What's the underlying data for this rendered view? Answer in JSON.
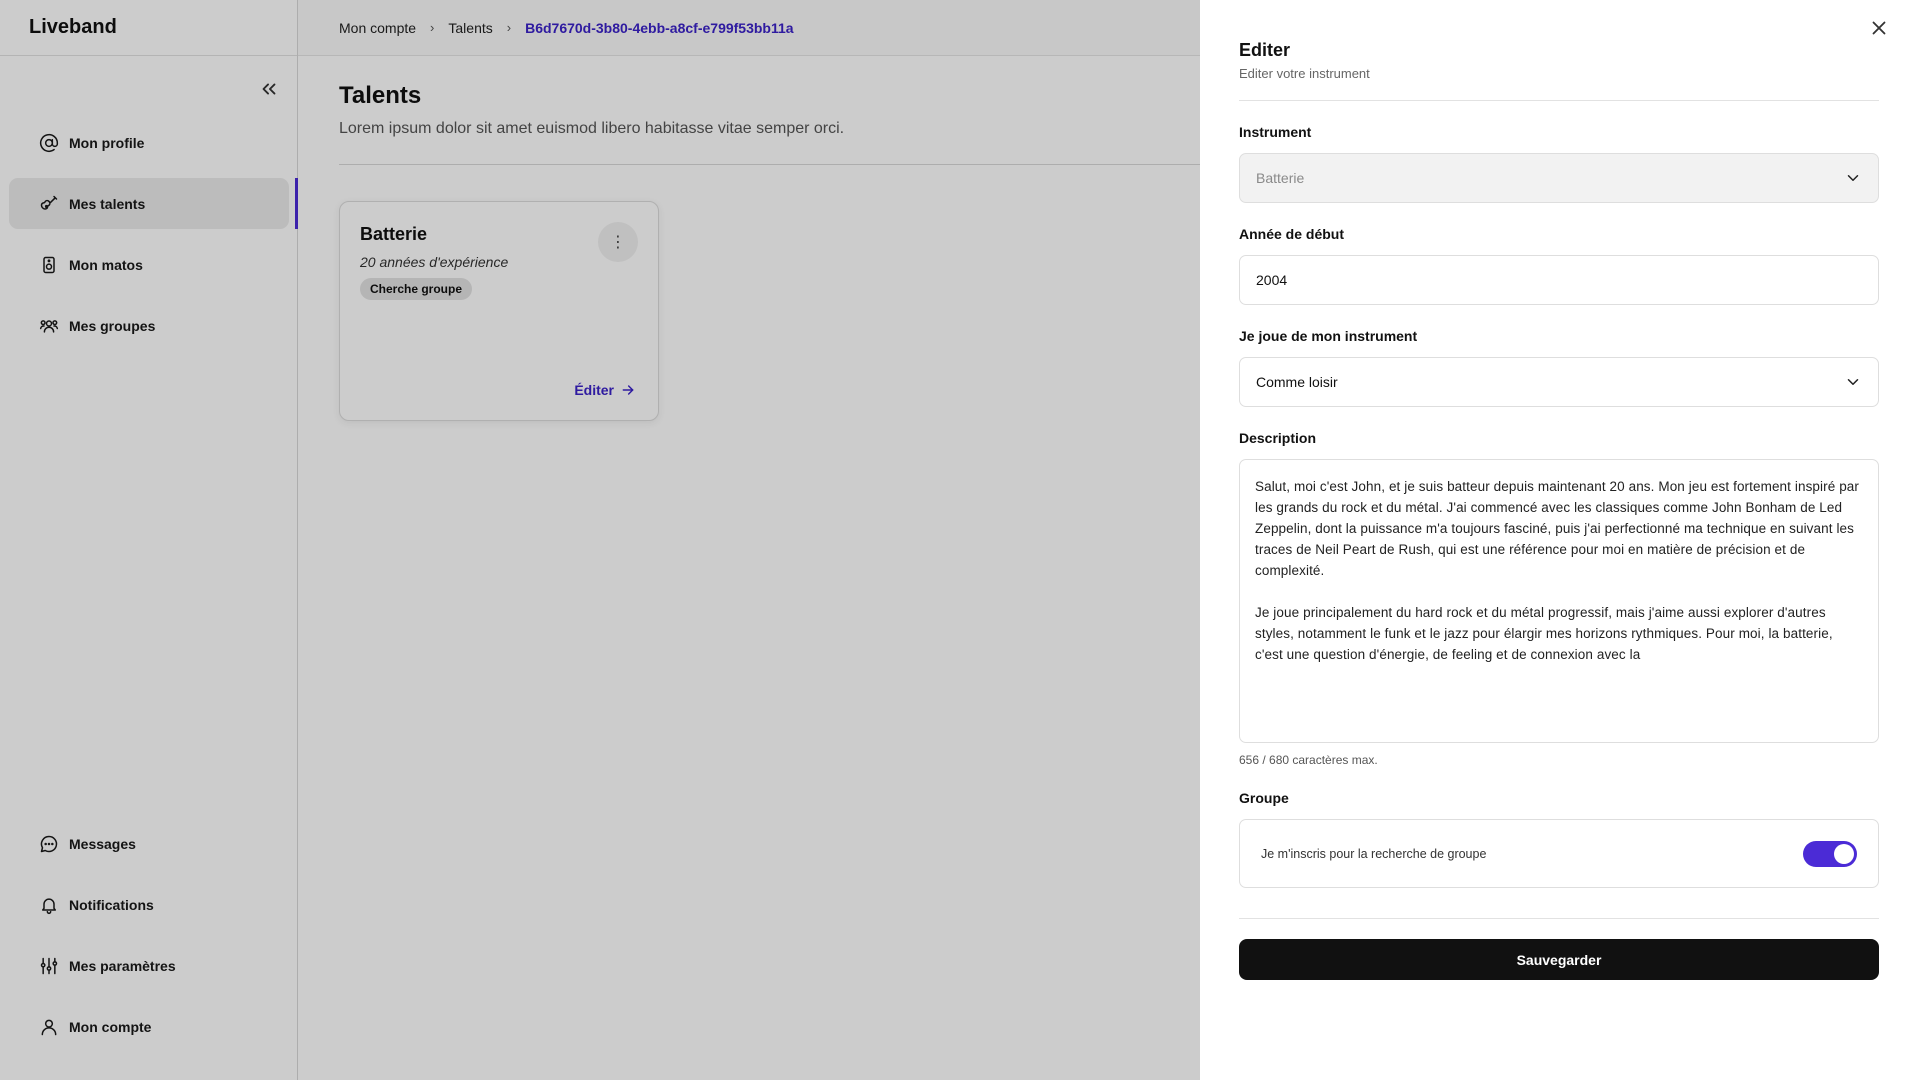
{
  "app": {
    "name": "Liveband"
  },
  "sidebar": {
    "top_items": [
      {
        "label": "Mon profile",
        "icon": "at-icon"
      },
      {
        "label": "Mes talents",
        "icon": "guitar-icon",
        "active": true
      },
      {
        "label": "Mon matos",
        "icon": "speaker-icon"
      },
      {
        "label": "Mes groupes",
        "icon": "users-icon"
      }
    ],
    "bottom_items": [
      {
        "label": "Messages",
        "icon": "message-icon"
      },
      {
        "label": "Notifications",
        "icon": "bell-icon"
      },
      {
        "label": "Mes paramètres",
        "icon": "sliders-icon"
      },
      {
        "label": "Mon compte",
        "icon": "user-icon"
      }
    ]
  },
  "breadcrumb": {
    "items": [
      "Mon compte",
      "Talents",
      "B6d7670d-3b80-4ebb-a8cf-e799f53bb11a"
    ]
  },
  "main": {
    "title": "Talents",
    "subtitle": "Lorem ipsum dolor sit amet euismod libero habitasse vitae semper orci.",
    "card": {
      "title": "Batterie",
      "experience": "20 années d'expérience",
      "badge": "Cherche groupe",
      "menu_glyph": "⋮",
      "edit_label": "Éditer"
    }
  },
  "drawer": {
    "title": "Editer",
    "subtitle": "Editer votre instrument",
    "instrument": {
      "label": "Instrument",
      "value": "Batterie"
    },
    "start_year": {
      "label": "Année de début",
      "value": "2004"
    },
    "play_mode": {
      "label": "Je joue de mon instrument",
      "value": "Comme loisir"
    },
    "description": {
      "label": "Description",
      "value": "Salut, moi c'est John, et je suis batteur depuis maintenant 20 ans. Mon jeu est fortement inspiré par les grands du rock et du métal. J'ai commencé avec les classiques comme John Bonham de Led Zeppelin, dont la puissance m'a toujours fasciné, puis j'ai perfectionné ma technique en suivant les traces de Neil Peart de Rush, qui est une référence pour moi en matière de précision et de complexité.\n\nJe joue principalement du hard rock et du métal progressif, mais j'aime aussi explorer d'autres styles, notamment le funk et le jazz pour élargir mes horizons rythmiques. Pour moi, la batterie, c'est une question d'énergie, de feeling et de connexion avec la",
      "counter": "656 / 680 caractères max."
    },
    "group": {
      "label": "Groupe",
      "toggle_label": "Je m'inscris pour la recherche de groupe",
      "enabled": true
    },
    "save_label": "Sauvegarder"
  },
  "colors": {
    "accent": "#4b2bd6",
    "link": "#3b22c9",
    "primary_button": "#111111"
  }
}
